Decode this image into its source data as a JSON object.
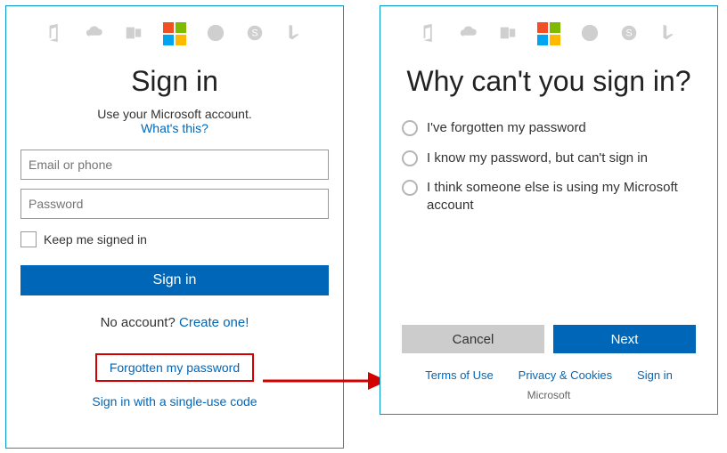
{
  "left": {
    "title": "Sign in",
    "subtitle": "Use your Microsoft account.",
    "whats_this": "What's this?",
    "email_placeholder": "Email or phone",
    "password_placeholder": "Password",
    "keep_signed_in": "Keep me signed in",
    "signin_button": "Sign in",
    "no_account": "No account?",
    "create_one": "Create one!",
    "forgot_password": "Forgotten my password",
    "single_use_code": "Sign in with a single-use code"
  },
  "right": {
    "title": "Why can't you sign in?",
    "options": [
      "I've forgotten my password",
      "I know my password, but can't sign in",
      "I think someone else is using my Microsoft account"
    ],
    "cancel": "Cancel",
    "next": "Next",
    "footer_terms": "Terms of Use",
    "footer_privacy": "Privacy & Cookies",
    "footer_signin": "Sign in",
    "footer_corp": "Microsoft"
  }
}
